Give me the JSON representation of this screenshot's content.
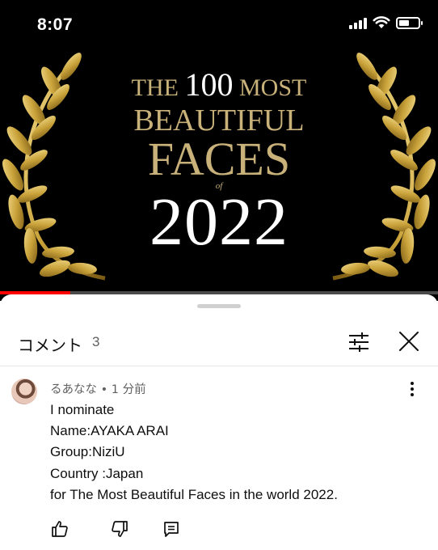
{
  "status_bar": {
    "time": "8:07"
  },
  "video": {
    "title_line1_prefix": "THE",
    "title_line1_number": "100",
    "title_line1_suffix": "MOST",
    "title_line2": "BEAUTIFUL",
    "title_line3": "FACES",
    "title_of": "of",
    "title_year": "2022",
    "progress": 0.16,
    "colors": {
      "gold": "#c9b17a",
      "progress": "#ff0000"
    }
  },
  "comments_panel": {
    "title": "コメント",
    "count": "3",
    "icons": {
      "filter": "sliders-icon",
      "close": "close-icon"
    }
  },
  "comment": {
    "author": "るあなな",
    "separator": "•",
    "time": "1 分前",
    "lines": [
      "I nominate",
      "Name:AYAKA ARAI",
      "Group:NiziU",
      "Country :Japan",
      "for The Most Beautiful Faces in the world 2022."
    ],
    "actions": [
      "thumbs-up-icon",
      "thumbs-down-icon",
      "reply-icon"
    ]
  }
}
